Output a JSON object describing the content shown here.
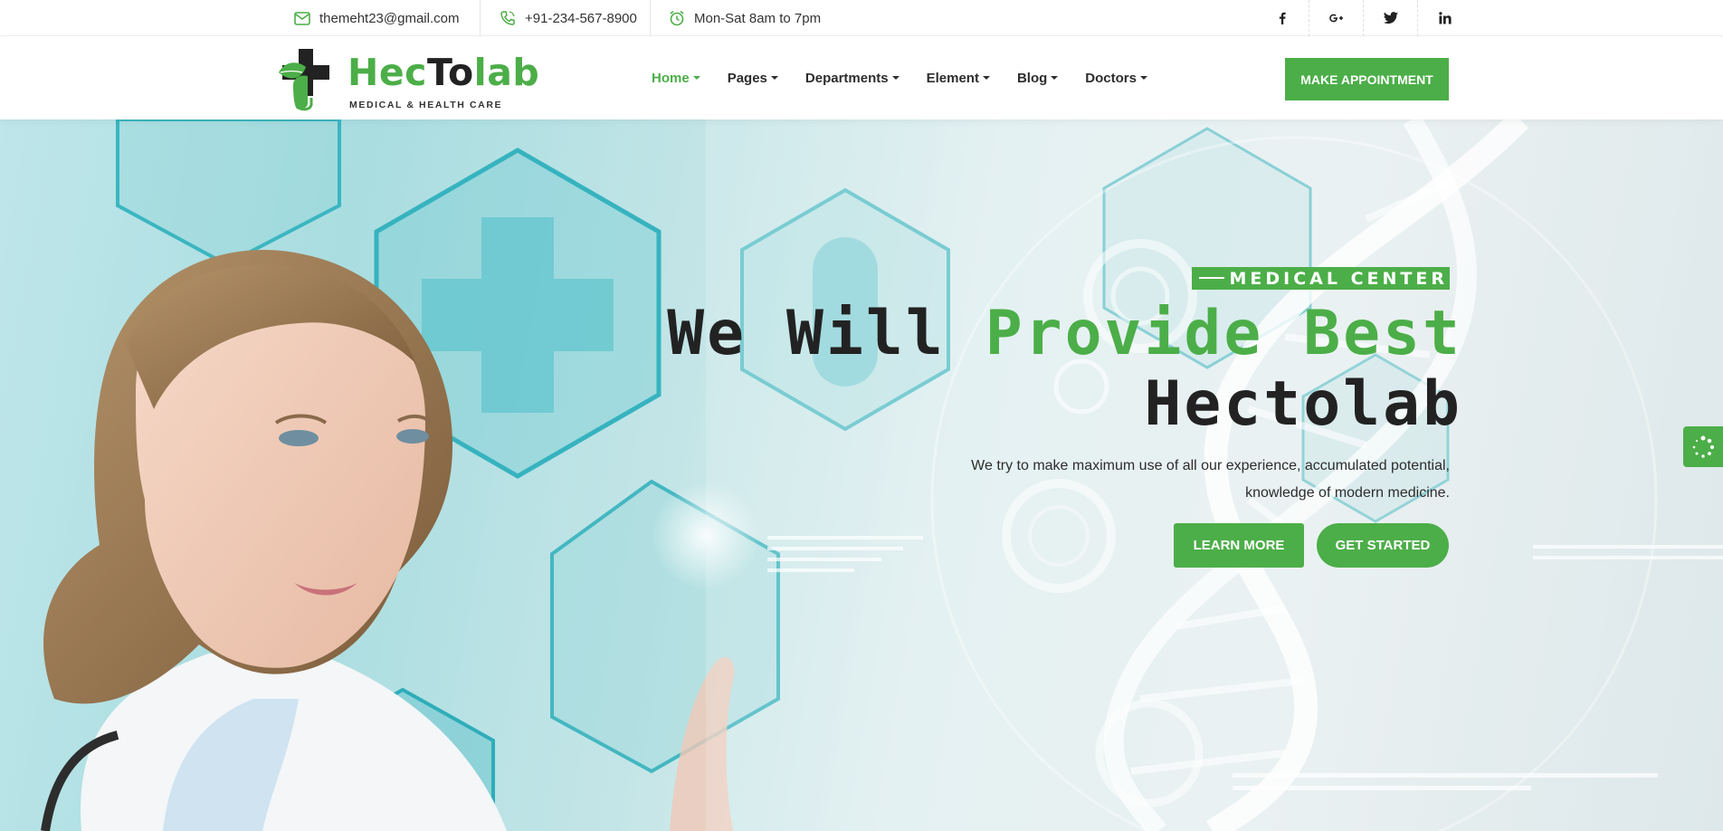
{
  "topbar": {
    "email": "themeht23@gmail.com",
    "phone": "+91-234-567-8900",
    "hours": "Mon-Sat 8am to 7pm",
    "social": [
      {
        "label": "f",
        "icon": "facebook-icon"
      },
      {
        "label": "G+",
        "icon": "google-plus-icon"
      },
      {
        "label": "twitter",
        "icon": "twitter-icon"
      },
      {
        "label": "in",
        "icon": "linkedin-icon"
      }
    ]
  },
  "header": {
    "logo": {
      "name_part1": "Hec",
      "name_part2": "To",
      "name_part3": "lab",
      "tagline": "MEDICAL & HEALTH CARE"
    },
    "nav": [
      {
        "label": "Home",
        "active": true
      },
      {
        "label": "Pages"
      },
      {
        "label": "Departments"
      },
      {
        "label": "Element"
      },
      {
        "label": "Blog"
      },
      {
        "label": "Doctors"
      }
    ],
    "appointment_label": "MAKE APPOINTMENT"
  },
  "hero": {
    "eyebrow": "MEDICAL CENTER",
    "headline_dark": "We Will ",
    "headline_green": "Provide Best",
    "headline_line2": "Hectolab",
    "description": "We try to make maximum use of all our experience, accumulated potential, knowledge of modern medicine.",
    "learn_more": "LEARN MORE",
    "get_started": "GET STARTED"
  },
  "colors": {
    "accent": "#4cae48",
    "dark": "#222222"
  }
}
